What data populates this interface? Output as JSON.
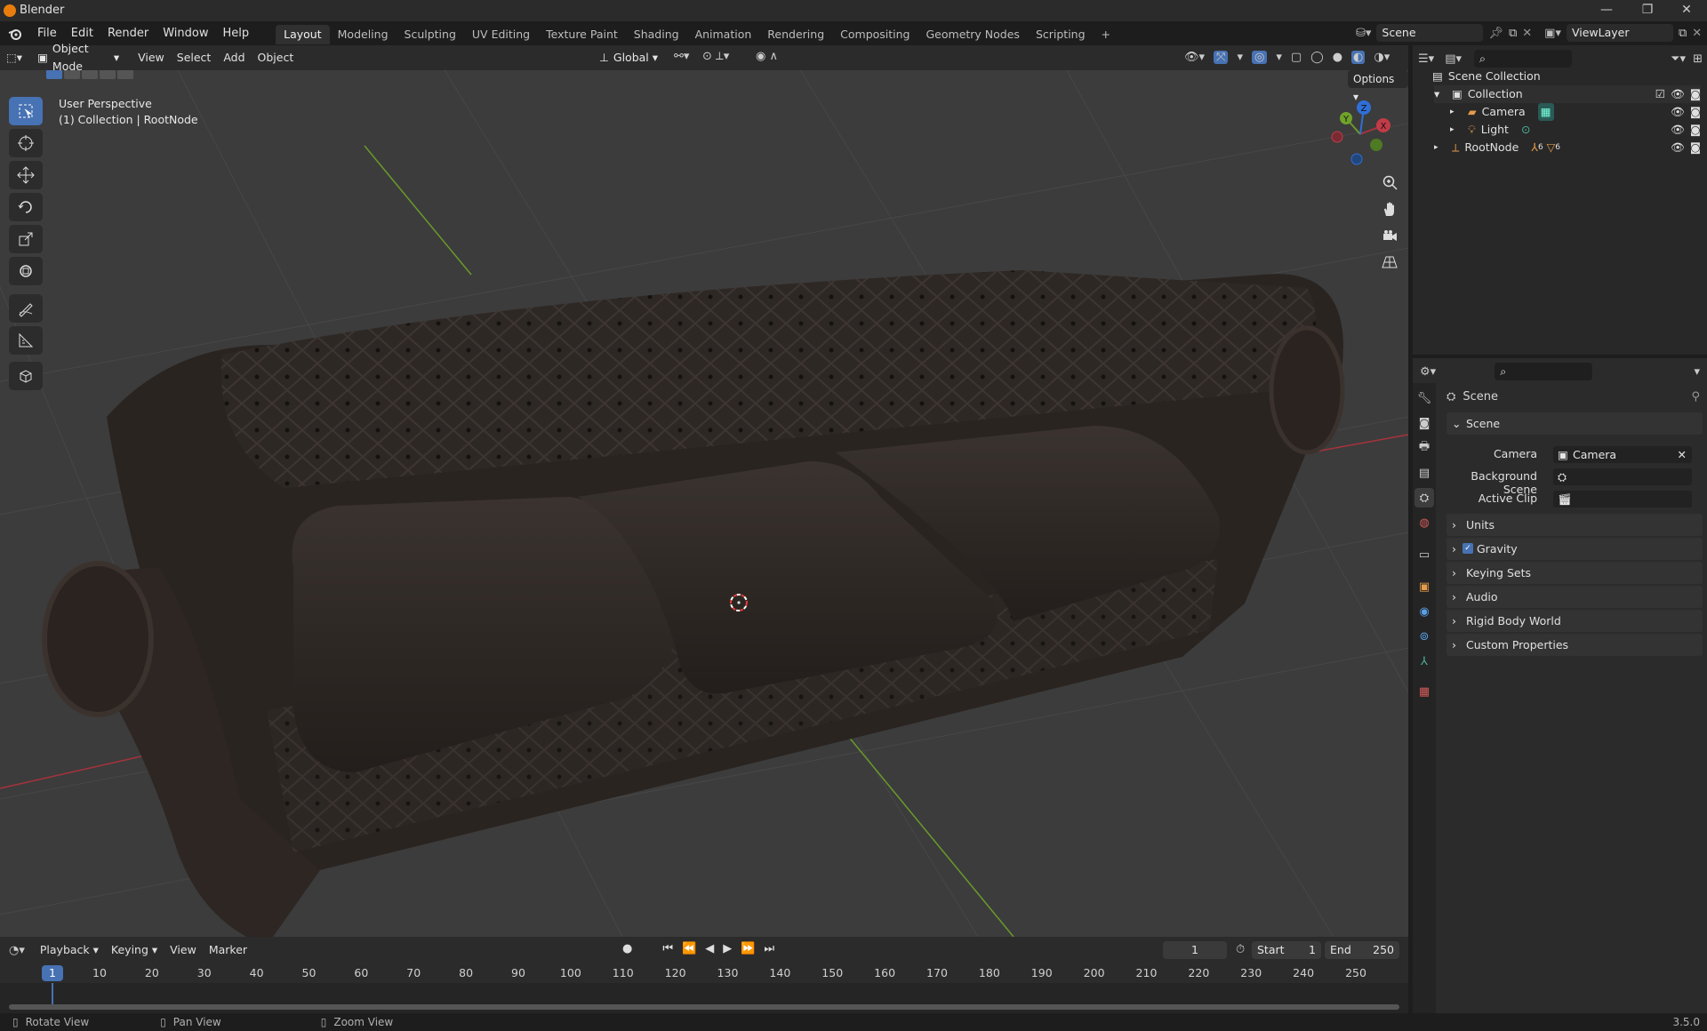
{
  "window": {
    "title": "Blender",
    "min_icon": "minimize-icon",
    "max_icon": "restore-icon",
    "close_icon": "close-icon"
  },
  "menus": [
    "File",
    "Edit",
    "Render",
    "Window",
    "Help"
  ],
  "workspaces": [
    "Layout",
    "Modeling",
    "Sculpting",
    "UV Editing",
    "Texture Paint",
    "Shading",
    "Animation",
    "Rendering",
    "Compositing",
    "Geometry Nodes",
    "Scripting",
    "+"
  ],
  "active_workspace": "Layout",
  "scene_field": "Scene",
  "viewlayer_field": "ViewLayer",
  "viewport": {
    "mode": "Object Mode",
    "menus": [
      "View",
      "Select",
      "Add",
      "Object"
    ],
    "orientation": "Global",
    "options": "Options",
    "overlay_line1": "User Perspective",
    "overlay_line2": "(1) Collection | RootNode",
    "gizmo": {
      "x": "X",
      "y": "Y",
      "z": "Z"
    }
  },
  "outliner": {
    "root": "Scene Collection",
    "items": [
      {
        "label": "Collection",
        "icon": "collection-icon"
      },
      {
        "label": "Camera",
        "icon": "camera-icon"
      },
      {
        "label": "Light",
        "icon": "light-icon"
      },
      {
        "label": "RootNode",
        "icon": "empty-icon",
        "badge1": "6",
        "badge2": "6"
      }
    ]
  },
  "properties": {
    "header": "Scene",
    "section": "Scene",
    "fields": [
      {
        "label": "Camera",
        "value": "Camera"
      },
      {
        "label": "Background Scene",
        "value": ""
      },
      {
        "label": "Active Clip",
        "value": ""
      }
    ],
    "panels": [
      "Units",
      "Gravity",
      "Keying Sets",
      "Audio",
      "Rigid Body World",
      "Custom Properties"
    ],
    "gravity_checked": true
  },
  "timeline": {
    "menus": [
      "Playback",
      "Keying",
      "View",
      "Marker"
    ],
    "current_frame": "1",
    "start_label": "Start",
    "start": "1",
    "end_label": "End",
    "end": "250",
    "ticks": [
      "1",
      "10",
      "20",
      "30",
      "40",
      "50",
      "60",
      "70",
      "80",
      "90",
      "100",
      "110",
      "120",
      "130",
      "140",
      "150",
      "160",
      "170",
      "180",
      "190",
      "200",
      "210",
      "220",
      "230",
      "240",
      "250"
    ]
  },
  "statusbar": {
    "rotate": "Rotate View",
    "pan": "Pan View",
    "zoom": "Zoom View",
    "version": "3.5.0"
  },
  "colors": {
    "accent": "#4772b3",
    "x_axis": "#a8323c",
    "y_axis": "#6a9a2a",
    "z_axis": "#2f6fd6"
  }
}
